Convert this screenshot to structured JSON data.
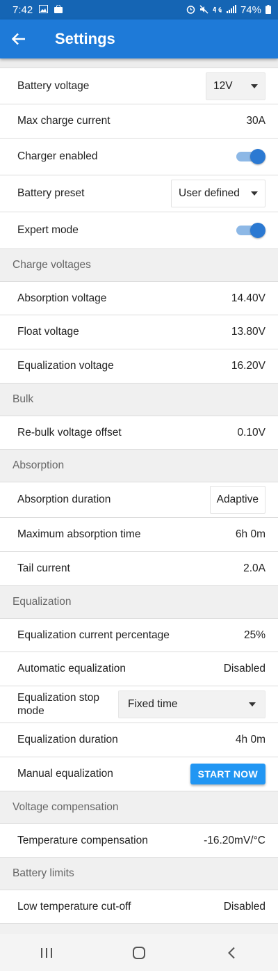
{
  "status_bar": {
    "time": "7:42",
    "battery": "74%",
    "icons": [
      "image-icon",
      "bag-icon",
      "alarm-icon",
      "mute-icon",
      "4g-icon",
      "signal-icon",
      "battery-icon"
    ]
  },
  "app_bar": {
    "title": "Settings",
    "back_icon": "arrow-left-icon"
  },
  "settings": {
    "battery_voltage": {
      "label": "Battery voltage",
      "value": "12V"
    },
    "max_charge_current": {
      "label": "Max charge current",
      "value": "30A"
    },
    "charger_enabled": {
      "label": "Charger enabled",
      "on": true
    },
    "battery_preset": {
      "label": "Battery preset",
      "value": "User defined"
    },
    "expert_mode": {
      "label": "Expert mode",
      "on": true
    }
  },
  "charge_voltages": {
    "header": "Charge voltages",
    "absorption_voltage": {
      "label": "Absorption voltage",
      "value": "14.40V"
    },
    "float_voltage": {
      "label": "Float voltage",
      "value": "13.80V"
    },
    "equalization_voltage": {
      "label": "Equalization voltage",
      "value": "16.20V"
    }
  },
  "bulk": {
    "header": "Bulk",
    "rebulk_offset": {
      "label": "Re-bulk voltage offset",
      "value": "0.10V"
    }
  },
  "absorption": {
    "header": "Absorption",
    "duration": {
      "label": "Absorption duration",
      "value": "Adaptive"
    },
    "max_time": {
      "label": "Maximum absorption time",
      "value": "6h 0m"
    },
    "tail_current": {
      "label": "Tail current",
      "value": "2.0A"
    }
  },
  "equalization": {
    "header": "Equalization",
    "current_percentage": {
      "label": "Equalization current percentage",
      "value": "25%"
    },
    "automatic": {
      "label": "Automatic equalization",
      "value": "Disabled"
    },
    "stop_mode": {
      "label_line1": "Equalization stop",
      "label_line2": "mode",
      "value": "Fixed time"
    },
    "duration": {
      "label": "Equalization duration",
      "value": "4h 0m"
    },
    "manual": {
      "label": "Manual equalization",
      "button": "START NOW"
    }
  },
  "voltage_compensation": {
    "header": "Voltage compensation",
    "temperature": {
      "label": "Temperature compensation",
      "value": "-16.20mV/°C"
    }
  },
  "battery_limits": {
    "header": "Battery limits",
    "low_temp_cutoff": {
      "label": "Low temperature cut-off",
      "value": "Disabled"
    }
  },
  "colors": {
    "status_bar": "#1565b4",
    "app_bar": "#1e7ad8",
    "accent": "#2196f3",
    "toggle_on": "#2b79d2"
  },
  "nav_bar": {
    "icons": [
      "recent-apps-icon",
      "home-icon",
      "back-icon"
    ]
  }
}
